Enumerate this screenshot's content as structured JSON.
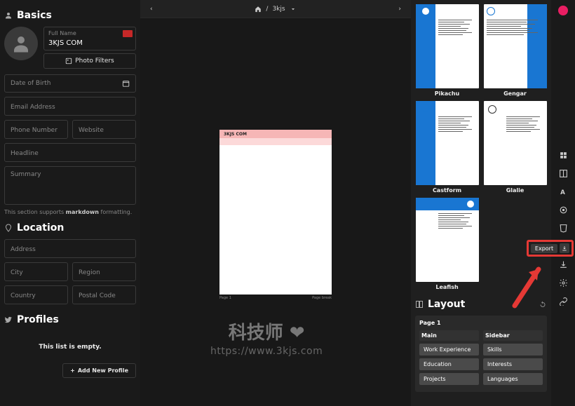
{
  "basics": {
    "title": "Basics",
    "full_name_label": "Full Name",
    "full_name_value": "3KJS COM",
    "photo_filters": "Photo Filters",
    "dob_ph": "Date of Birth",
    "email_ph": "Email Address",
    "phone_ph": "Phone Number",
    "website_ph": "Website",
    "headline_ph": "Headline",
    "summary_ph": "Summary",
    "markdown_hint_pre": "This section supports ",
    "markdown_hint_bold": "markdown",
    "markdown_hint_post": " formatting."
  },
  "location": {
    "title": "Location",
    "address_ph": "Address",
    "city_ph": "City",
    "region_ph": "Region",
    "country_ph": "Country",
    "postal_ph": "Postal Code"
  },
  "profiles": {
    "title": "Profiles",
    "empty": "This list is empty.",
    "add": "Add New Profile"
  },
  "breadcrumb": {
    "home": "⌂",
    "sep": "/",
    "name": "3kjs"
  },
  "page": {
    "title": "3KJS COM",
    "foot_l": "Page 1",
    "foot_r": "Page break"
  },
  "templates": [
    {
      "name": "Pikachu"
    },
    {
      "name": "Gengar"
    },
    {
      "name": "Castform"
    },
    {
      "name": "Glalie"
    },
    {
      "name": "Leafish"
    }
  ],
  "layout": {
    "title": "Layout",
    "page_label": "Page 1",
    "main_label": "Main",
    "sidebar_label": "Sidebar",
    "main_items": [
      "Work Experience",
      "Education",
      "Projects"
    ],
    "sidebar_items": [
      "Skills",
      "Interests",
      "Languages"
    ]
  },
  "export": {
    "label": "Export"
  },
  "watermark": {
    "cn": "科技师 ❤",
    "url": "https://www.3kjs.com"
  },
  "chart_data": null
}
